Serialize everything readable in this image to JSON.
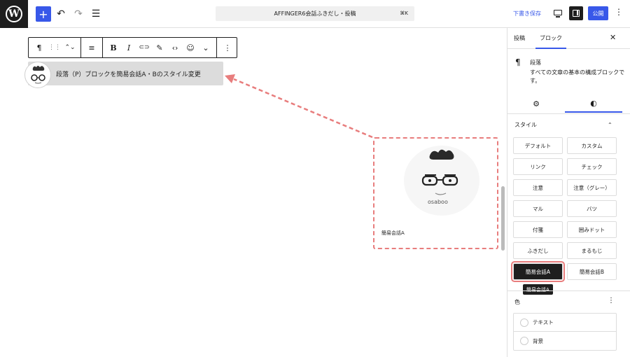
{
  "topbar": {
    "logo_icon": "wordpress-logo",
    "logo_letter": "W",
    "add_icon": "+",
    "undo_icon": "↶",
    "redo_icon": "↷",
    "list_view_icon": "☰",
    "document_title": "AFFINGER6会話ふきだし・投稿",
    "shortcut": "⌘K",
    "save_draft": "下書き保存",
    "publish": "公開",
    "more_icon": "⋮"
  },
  "toolbar": {
    "paragraph_icon": "¶",
    "drag_icon": "⋮⋮",
    "move_icon": "⌃⌄",
    "align_icon": "≡",
    "bold": "B",
    "italic": "I",
    "link_icon": "⊂⊃",
    "highlight_icon": "✎",
    "code_icon": "‹›",
    "emoji_icon": "☺",
    "dropdown_icon": "⌄",
    "options_icon": "⋮"
  },
  "paragraph": {
    "text": "段落（P）ブロックを簡易会話A・Bのスタイル変更"
  },
  "preview": {
    "caption": "簡易会話A",
    "brand_text": "osaboo"
  },
  "sidebar": {
    "tab_post": "投稿",
    "tab_block": "ブロック",
    "close_icon": "✕",
    "block_icon": "¶",
    "block_title": "段落",
    "block_description": "すべての文章の基本の構成ブロックです。",
    "settings_icon": "⚙",
    "styles_icon": "◐",
    "styles_title": "スタイル",
    "styles_chevron": "⌃",
    "styles": [
      {
        "label": "デフォルト"
      },
      {
        "label": "カスタム"
      },
      {
        "label": "リンク"
      },
      {
        "label": "チェック"
      },
      {
        "label": "注意"
      },
      {
        "label": "注意（グレー）"
      },
      {
        "label": "マル"
      },
      {
        "label": "バツ"
      },
      {
        "label": "付箋"
      },
      {
        "label": "囲みドット"
      },
      {
        "label": "ふきだし"
      },
      {
        "label": "まるもじ"
      },
      {
        "label": "簡易会話A"
      },
      {
        "label": "簡易会話B"
      }
    ],
    "active_style": "簡易会話A",
    "tooltip": "簡易会話A",
    "color_title": "色",
    "color_more_icon": "⋮",
    "color_items": [
      {
        "label": "テキスト"
      },
      {
        "label": "背景"
      }
    ]
  },
  "colors": {
    "accent": "#3858e9",
    "highlight_dashed": "#e87d7d",
    "dark": "#1e1e1e"
  }
}
